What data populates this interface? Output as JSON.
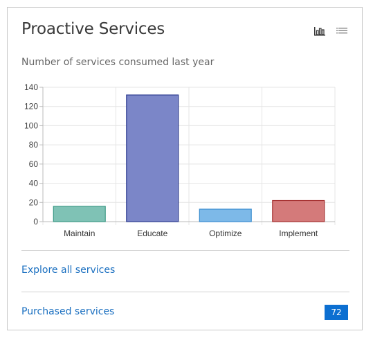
{
  "card": {
    "title": "Proactive Services",
    "view_icons": [
      "bar-chart-icon",
      "list-icon"
    ],
    "subtitle": "Number of services consumed last year"
  },
  "chart_data": {
    "type": "bar",
    "categories": [
      "Maintain",
      "Educate",
      "Optimize",
      "Implement"
    ],
    "values": [
      16,
      132,
      13,
      22
    ],
    "ylim": [
      0,
      140
    ],
    "yticks": [
      0,
      20,
      40,
      60,
      80,
      100,
      120,
      140
    ],
    "grid": true,
    "colors": [
      {
        "fill": "#7fc2b5",
        "stroke": "#3e9a87"
      },
      {
        "fill": "#7b86c8",
        "stroke": "#2c3b8f"
      },
      {
        "fill": "#7db9e8",
        "stroke": "#3a8dd0"
      },
      {
        "fill": "#d47a7a",
        "stroke": "#a53030"
      }
    ]
  },
  "links": {
    "explore": "Explore all services",
    "purchased": "Purchased services",
    "purchased_count": "72"
  },
  "colors": {
    "link": "#1a6fc0",
    "badge": "#0c6fd1"
  }
}
